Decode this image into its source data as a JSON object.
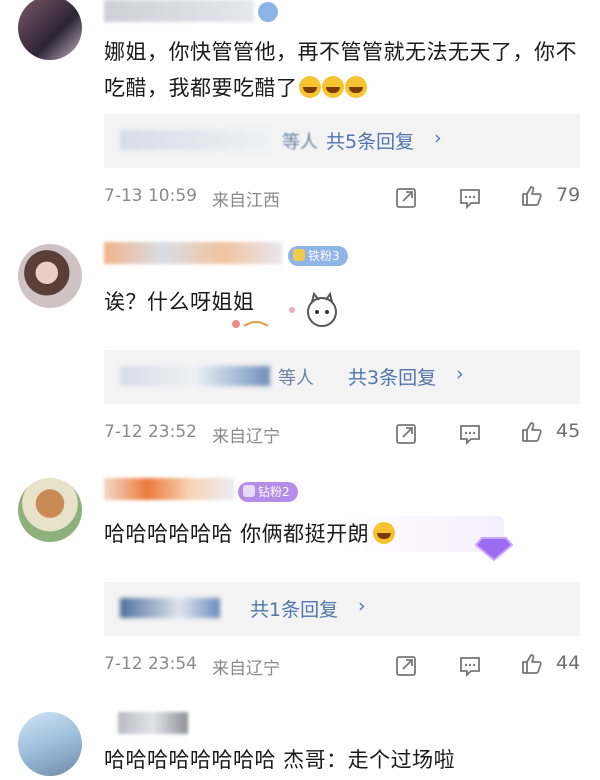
{
  "comments": [
    {
      "text": "娜姐，你快管管他，再不管管就无法无天了，你不吃醋，我都要吃醋了",
      "reply_suffix": "等人",
      "reply_count": "共5条回复",
      "time": "7-13 10:59",
      "location": "来自江西",
      "likes": "79"
    },
    {
      "badge": "铁粉3",
      "text": "诶？什么呀姐姐",
      "reply_suffix": "等人",
      "reply_count": "共3条回复",
      "time": "7-12 23:52",
      "location": "来自辽宁",
      "likes": "45"
    },
    {
      "badge": "钻粉2",
      "text": "哈哈哈哈哈哈 你俩都挺开朗",
      "reply_count": "共1条回复",
      "time": "7-12 23:54",
      "location": "来自辽宁",
      "likes": "44"
    },
    {
      "text": "哈哈哈哈哈哈哈哈  杰哥：走个过场啦"
    }
  ],
  "icons": {
    "share": "share-icon",
    "comment": "comment-icon",
    "like": "thumbs-up-icon"
  },
  "colors": {
    "reply_link": "#4f77ad",
    "meta": "#8a8a8a",
    "reply_bg": "#f3f3f3",
    "badge_iron": "#8fb4e8",
    "badge_diamond": "#b58ce8"
  }
}
